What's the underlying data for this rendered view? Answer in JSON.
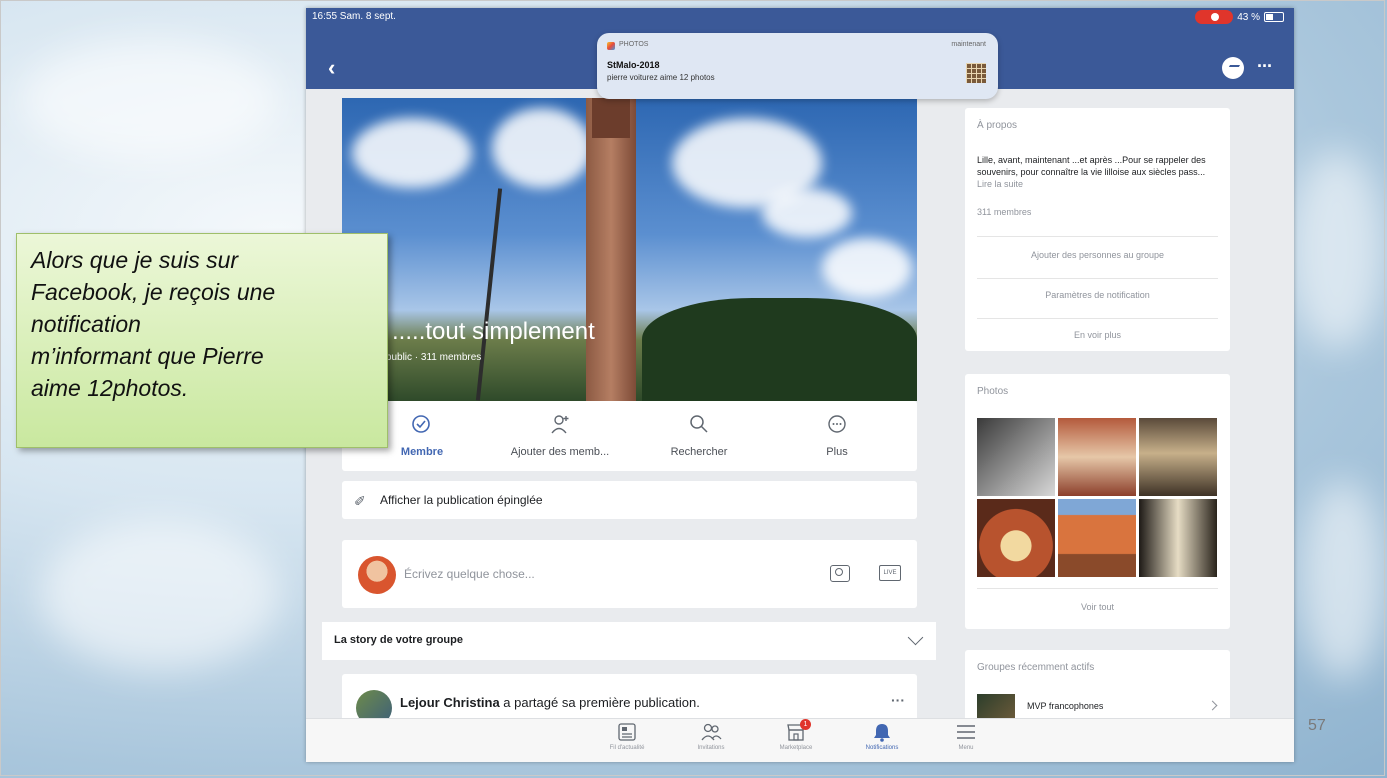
{
  "slide": {
    "number": "57"
  },
  "status_bar": {
    "time": "16:55  Sam. 8 sept.",
    "battery": "43 %"
  },
  "notification": {
    "app": "PHOTOS",
    "time": "maintenant",
    "title": "StMalo-2018",
    "body": "pierre voiturez aime 12 photos"
  },
  "group": {
    "cover_title": "e .....tout simplement",
    "cover_subtitle": "pe public · 311 membres",
    "actions": [
      "Membre",
      "Ajouter des memb...",
      "Rechercher",
      "Plus"
    ],
    "pinned": "Afficher la publication épinglée",
    "composer_placeholder": "Écrivez quelque chose...",
    "live_label": "LIVE",
    "story_header": "La story de votre groupe",
    "post": {
      "author": "Lejour Christina",
      "text": " a partagé sa première publication."
    }
  },
  "sidebar": {
    "about": {
      "heading": "À propos",
      "description": "Lille, avant, maintenant ...et après ...Pour se rappeler des souvenirs, pour connaître la vie lilloise aux siècles pass... ",
      "read_more": "Lire la suite",
      "members": "311 membres",
      "links": [
        "Ajouter des personnes au groupe",
        "Paramètres de notification",
        "En voir plus"
      ]
    },
    "photos": {
      "heading": "Photos",
      "see_all": "Voir tout"
    },
    "groups": {
      "heading": "Groupes récemment actifs",
      "item": "MVP francophones"
    }
  },
  "tabbar": {
    "items": [
      "Fil d'actualité",
      "Invitations",
      "Marketplace",
      "Notifications",
      "Menu"
    ],
    "marketplace_badge": "1"
  },
  "callout": {
    "text": "Alors que je suis sur\nFacebook, je reçois une\nnotification\nm’informant que Pierre\naime 12photos."
  },
  "colors": {
    "facebook_blue": "#3b5998",
    "accent": "#4267b2",
    "callout_green": "#c9e89f"
  }
}
